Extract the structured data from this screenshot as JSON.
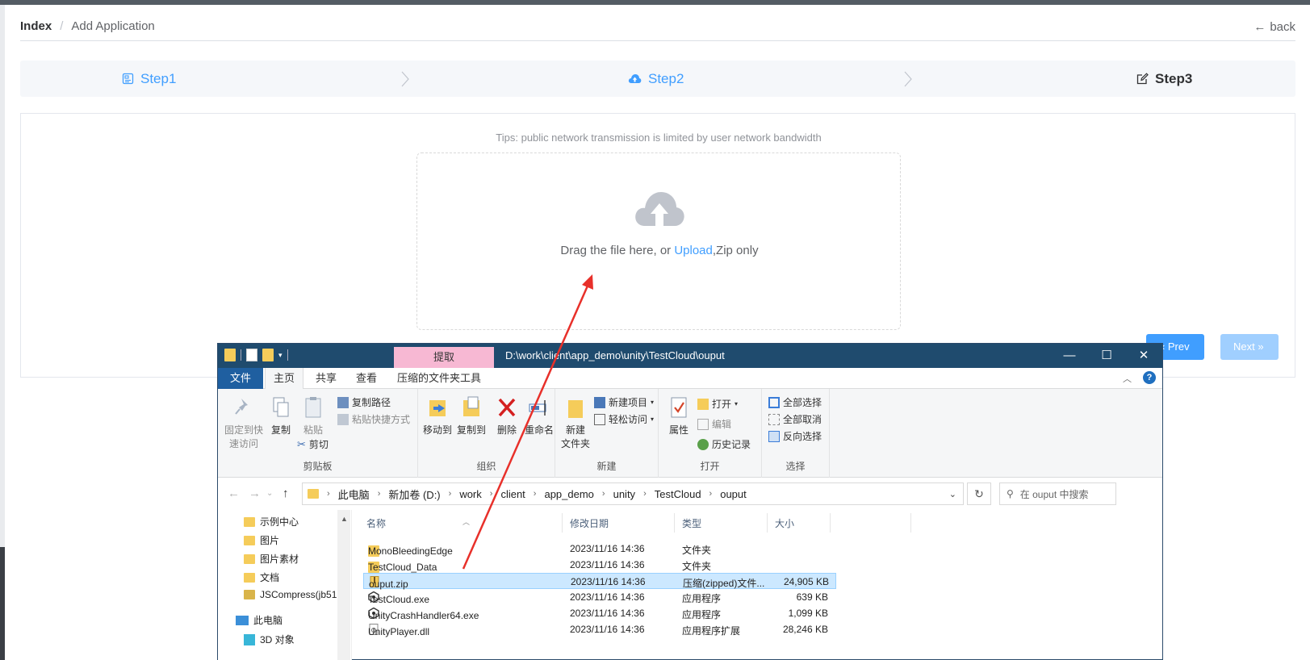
{
  "breadcrumb": {
    "root": "Index",
    "sep": "/",
    "current": "Add Application"
  },
  "back_label": "back",
  "steps": [
    {
      "label": "Step1",
      "state": "done"
    },
    {
      "label": "Step2",
      "state": "done"
    },
    {
      "label": "Step3",
      "state": "active"
    }
  ],
  "upload": {
    "tips": "Tips: public network transmission is limited by user network bandwidth",
    "drag_text": "Drag the file here, or ",
    "upload_link": "Upload",
    "suffix": ",Zip only"
  },
  "buttons": {
    "prev": "Prev",
    "next": "Next"
  },
  "explorer": {
    "extract_tab": "提取",
    "title_path": "D:\\work\\client\\app_demo\\unity\\TestCloud\\ouput",
    "menu": {
      "file": "文件",
      "home": "主页",
      "share": "共享",
      "view": "查看",
      "zip": "压缩的文件夹工具"
    },
    "ribbon": {
      "pin_line1": "固定到快",
      "pin_line2": "速访问",
      "copy": "复制",
      "paste": "粘贴",
      "copy_path": "复制路径",
      "paste_shortcut": "粘贴快捷方式",
      "cut": "剪切",
      "group_clipboard": "剪贴板",
      "move_to": "移动到",
      "copy_to": "复制到",
      "delete": "删除",
      "rename": "重命名",
      "group_organize": "组织",
      "new_folder_line1": "新建",
      "new_folder_line2": "文件夹",
      "new_item": "新建项目",
      "easy_access": "轻松访问",
      "group_new": "新建",
      "properties": "属性",
      "open": "打开",
      "edit": "编辑",
      "history": "历史记录",
      "group_open": "打开",
      "select_all": "全部选择",
      "select_none": "全部取消",
      "invert_selection": "反向选择",
      "group_select": "选择"
    },
    "address": [
      "此电脑",
      "新加卷 (D:)",
      "work",
      "client",
      "app_demo",
      "unity",
      "TestCloud",
      "ouput"
    ],
    "search_placeholder": "在 ouput 中搜索",
    "nav": [
      "示例中心",
      "图片",
      "图片素材",
      "文档",
      "JSCompress(jb51.",
      "此电脑",
      "3D 对象"
    ],
    "columns": {
      "name": "名称",
      "date": "修改日期",
      "type": "类型",
      "size": "大小"
    },
    "files": [
      {
        "name": "MonoBleedingEdge",
        "date": "2023/11/16 14:36",
        "type": "文件夹",
        "size": "",
        "icon": "folder-icon"
      },
      {
        "name": "TestCloud_Data",
        "date": "2023/11/16 14:36",
        "type": "文件夹",
        "size": "",
        "icon": "folder-icon"
      },
      {
        "name": "ouput.zip",
        "date": "2023/11/16 14:36",
        "type": "压缩(zipped)文件...",
        "size": "24,905 KB",
        "icon": "zip-icon",
        "selected": true
      },
      {
        "name": "TestCloud.exe",
        "date": "2023/11/16 14:36",
        "type": "应用程序",
        "size": "639 KB",
        "icon": "unity-icon"
      },
      {
        "name": "UnityCrashHandler64.exe",
        "date": "2023/11/16 14:36",
        "type": "应用程序",
        "size": "1,099 KB",
        "icon": "unity-icon"
      },
      {
        "name": "UnityPlayer.dll",
        "date": "2023/11/16 14:36",
        "type": "应用程序扩展",
        "size": "28,246 KB",
        "icon": "dll-icon"
      }
    ]
  },
  "colors": {
    "primary": "#409eff",
    "primary_light": "#a0cfff",
    "annotation": "#e8302a",
    "titlebar": "#1f4b6e"
  }
}
